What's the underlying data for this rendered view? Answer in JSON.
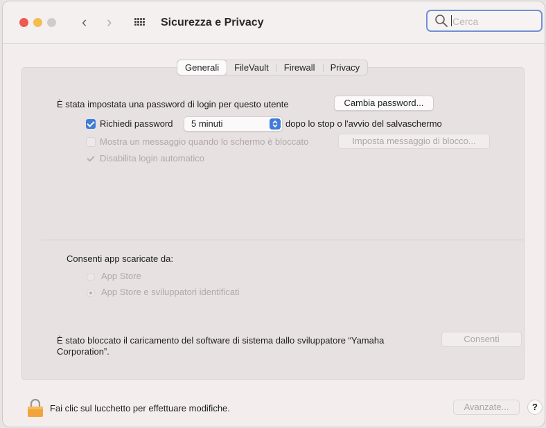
{
  "window": {
    "title": "Sicurezza e Privacy",
    "search_placeholder": "Cerca"
  },
  "tabs": [
    {
      "label": "Generali",
      "selected": true
    },
    {
      "label": "FileVault",
      "selected": false
    },
    {
      "label": "Firewall",
      "selected": false
    },
    {
      "label": "Privacy",
      "selected": false
    }
  ],
  "general": {
    "password_text": "È stata impostata una password di login per questo utente",
    "change_password_button": "Cambia password...",
    "require_password": {
      "label": "Richiedi password",
      "checked": true
    },
    "require_password_delay": "5 minuti",
    "require_password_suffix": "dopo lo stop o l'avvio del salvaschermo",
    "show_message": {
      "label": "Mostra un messaggio quando lo schermo è bloccato",
      "checked": false,
      "enabled": false
    },
    "set_message_button": "Imposta messaggio di blocco...",
    "disable_auto_login": {
      "label": "Disabilita login automatico",
      "checked": true,
      "enabled": false
    }
  },
  "downloads": {
    "heading": "Consenti app scaricate da:",
    "options": [
      {
        "label": "App Store",
        "selected": false
      },
      {
        "label": "App Store e sviluppatori identificati",
        "selected": true
      }
    ]
  },
  "blocked": {
    "text_line1": "È stato bloccato il caricamento del software di sistema dallo sviluppatore “Yamaha",
    "text_line2": "Corporation”.",
    "allow_button": "Consenti"
  },
  "footer": {
    "lock_text": "Fai clic sul lucchetto per effettuare modifiche.",
    "advanced_button": "Avanzate...",
    "help_button": "?"
  },
  "colors": {
    "accent": "#3f7bd9",
    "close": "#ee5a52",
    "minimize": "#f4bd4f",
    "zoom_inactive": "#cfcccc"
  }
}
